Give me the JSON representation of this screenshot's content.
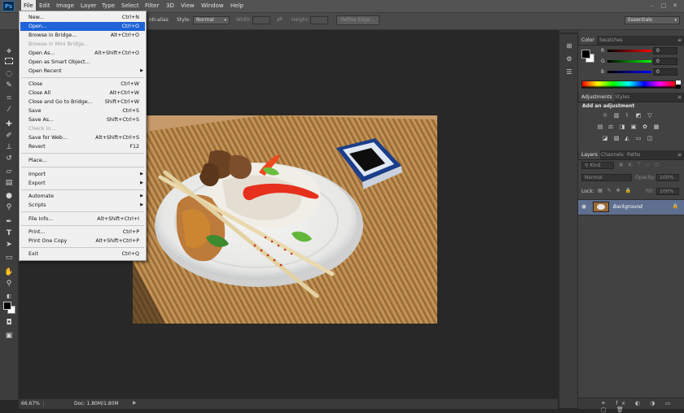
{
  "app": {
    "logo": "Ps"
  },
  "menubar": {
    "items": [
      "File",
      "Edit",
      "Image",
      "Layer",
      "Type",
      "Select",
      "Filter",
      "3D",
      "View",
      "Window",
      "Help"
    ],
    "window_buttons": [
      "–",
      "□",
      "✕"
    ]
  },
  "options_bar": {
    "anti_alias": "nti-alias",
    "style_label": "Style:",
    "style_value": "Normal",
    "width_label": "Width:",
    "swap_icon": "⇄",
    "height_label": "Height:",
    "refine_edge": "Refine Edge...",
    "workspace": "Essentials"
  },
  "file_menu": {
    "items": [
      {
        "label": "New...",
        "shortcut": "Ctrl+N"
      },
      {
        "label": "Open...",
        "shortcut": "Ctrl+O",
        "highlighted": true
      },
      {
        "label": "Browse in Bridge...",
        "shortcut": "Alt+Ctrl+O"
      },
      {
        "label": "Browse in Mini Bridge...",
        "shortcut": "",
        "disabled": true
      },
      {
        "label": "Open As...",
        "shortcut": "Alt+Shift+Ctrl+O"
      },
      {
        "label": "Open as Smart Object...",
        "shortcut": ""
      },
      {
        "label": "Open Recent",
        "shortcut": "",
        "submenu": true
      },
      {
        "label": "Close",
        "shortcut": "Ctrl+W"
      },
      {
        "label": "Close All",
        "shortcut": "Alt+Ctrl+W"
      },
      {
        "label": "Close and Go to Bridge...",
        "shortcut": "Shift+Ctrl+W"
      },
      {
        "label": "Save",
        "shortcut": "Ctrl+S"
      },
      {
        "label": "Save As...",
        "shortcut": "Shift+Ctrl+S"
      },
      {
        "label": "Check In...",
        "shortcut": "",
        "disabled": true
      },
      {
        "label": "Save for Web...",
        "shortcut": "Alt+Shift+Ctrl+S"
      },
      {
        "label": "Revert",
        "shortcut": "F12"
      },
      {
        "label": "Place...",
        "shortcut": ""
      },
      {
        "label": "Import",
        "shortcut": "",
        "submenu": true
      },
      {
        "label": "Export",
        "shortcut": "",
        "submenu": true
      },
      {
        "label": "Automate",
        "shortcut": "",
        "submenu": true
      },
      {
        "label": "Scripts",
        "shortcut": "",
        "submenu": true
      },
      {
        "label": "File Info...",
        "shortcut": "Alt+Shift+Ctrl+I"
      },
      {
        "label": "Print...",
        "shortcut": "Ctrl+P"
      },
      {
        "label": "Print One Copy",
        "shortcut": "Alt+Shift+Ctrl+P"
      },
      {
        "label": "Exit",
        "shortcut": "Ctrl+Q"
      }
    ]
  },
  "status": {
    "zoom": "66.67%",
    "doc": "Doc: 1.80M/1.80M"
  },
  "color_panel": {
    "tabs": [
      "Color",
      "Swatches"
    ],
    "sliders": [
      {
        "label": "R",
        "value": "0",
        "color": "#d02a2a"
      },
      {
        "label": "G",
        "value": "0",
        "color": "#2fb52f"
      },
      {
        "label": "B",
        "value": "0",
        "color": "#2a3fd0"
      }
    ]
  },
  "adjustments_panel": {
    "tabs": [
      "Adjustments",
      "Styles"
    ],
    "heading": "Add an adjustment"
  },
  "layers_panel": {
    "tabs": [
      "Layers",
      "Channels",
      "Paths"
    ],
    "kind": "Kind",
    "blend_mode": "Normal",
    "opacity_label": "Opacity:",
    "opacity_value": "100%",
    "lock_label": "Lock:",
    "fill_label": "Fill:",
    "fill_value": "100%",
    "layer_name": "Background"
  },
  "colors": {
    "ui_dark": "#282828",
    "menu_highlight": "#1f63d6",
    "layer_selected": "#5e6f8f"
  }
}
